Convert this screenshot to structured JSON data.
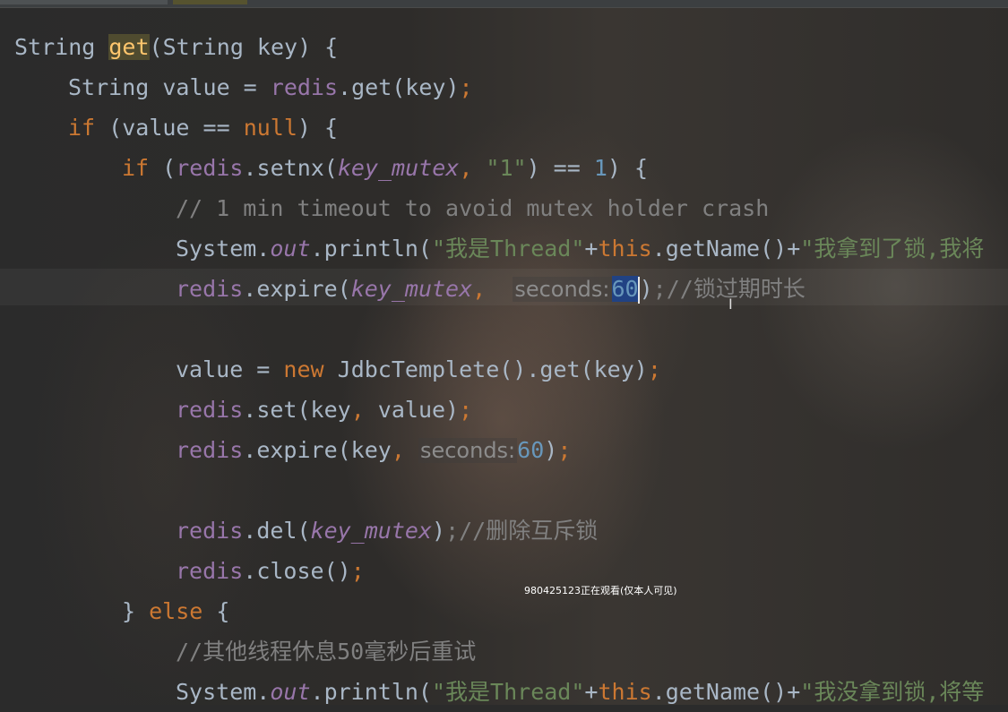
{
  "editor": {
    "lines": [
      {
        "a": "String ",
        "b": "get",
        "c": "(String key) {"
      },
      {
        "a": "String value = ",
        "b": "redis",
        "c": ".get(key)",
        "d": ";"
      },
      {
        "a": "if",
        "b": " (value == ",
        "c": "null",
        "d": ") {"
      },
      {
        "a": "if",
        "b": " (",
        "c": "redis",
        "d": ".setnx(",
        "e": "key_mutex",
        "f": ", ",
        "g": "\"1\"",
        "h": ") == ",
        "i": "1",
        "j": ") {"
      },
      {
        "a": "// 1 min timeout to avoid mutex holder crash"
      },
      {
        "a": "System.",
        "b": "out",
        "c": ".println(",
        "d": "\"我是Thread\"",
        "e": "+",
        "f": "this",
        "g": ".getName()+",
        "h": "\"我拿到了锁,我将"
      },
      {
        "a": "redis",
        "b": ".expire(",
        "c": "key_mutex",
        "d": ",  ",
        "e": "seconds:",
        "f": "60",
        "g": ")",
        "h": ";//锁过期时长"
      },
      {
        "a": "value = ",
        "b": "new ",
        "c": "JdbcTemplete().get(key)",
        "d": ";"
      },
      {
        "a": "redis",
        "b": ".set(key",
        "c": ", ",
        "d": "value)",
        "e": ";"
      },
      {
        "a": "redis",
        "b": ".expire(key",
        "c": ", ",
        "d": "seconds:",
        "e": "60",
        "f": ")",
        "g": ";"
      },
      {
        "a": "redis",
        "b": ".del(",
        "c": "key_mutex",
        "d": ")",
        "e": ";//删除互斥锁"
      },
      {
        "a": "redis",
        "b": ".close()",
        "c": ";"
      },
      {
        "a": "} ",
        "b": "else",
        "c": " {"
      },
      {
        "a": "//其他线程休息50毫秒后重试"
      },
      {
        "a": "System.",
        "b": "out",
        "c": ".println(",
        "d": "\"我是Thread\"",
        "e": "+",
        "f": "this",
        "g": ".getName()+",
        "h": "\"我没拿到锁,将等"
      }
    ]
  },
  "overlay": {
    "watermark": "980425123正在观看(仅本人可见)",
    "cursor_glyph": "I"
  },
  "colors": {
    "background": "#2b2b2b",
    "keyword": "#cc7832",
    "field": "#9876aa",
    "string": "#6a8759",
    "number": "#6897bb",
    "comment": "#808080",
    "text": "#a9b7c6",
    "method_highlight": "#ffc66d",
    "selection": "#214283"
  }
}
